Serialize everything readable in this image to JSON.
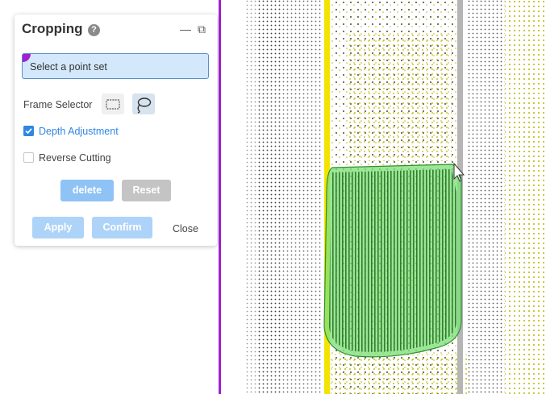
{
  "panel": {
    "title": "Cropping",
    "help_icon": "?",
    "minimize_icon": "—",
    "restore_icon": "⧉",
    "point_set_select": {
      "placeholder": "Select a point set"
    },
    "frame_selector": {
      "label": "Frame Selector",
      "options": [
        "rectangle-icon",
        "lasso-icon"
      ],
      "selected": "lasso-icon"
    },
    "depth_adjustment": {
      "label": "Depth Adjustment",
      "checked": true
    },
    "reverse_cutting": {
      "label": "Reverse Cutting",
      "checked": false
    },
    "buttons": {
      "delete": "delete",
      "reset": "Reset",
      "apply": "Apply",
      "confirm": "Confirm",
      "close": "Close"
    }
  },
  "colors": {
    "accent_blue": "#2f86e3",
    "selection_fill": "#7fe07a",
    "selection_outline": "#2f8f2f",
    "pole_yellow": "#f2e400",
    "vertical_purple": "#a21fd3",
    "point_yellow": "#b8b800"
  }
}
